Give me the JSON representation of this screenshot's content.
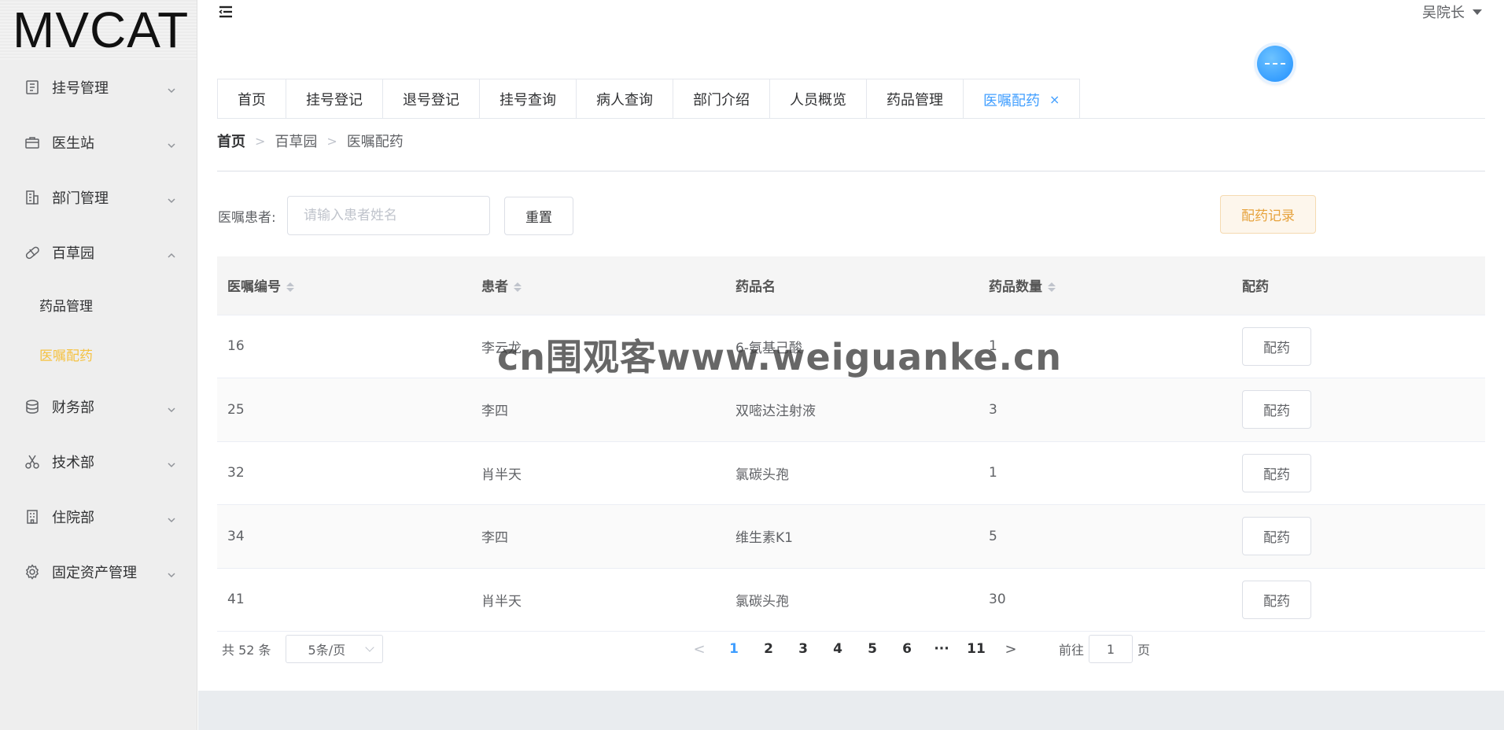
{
  "app": {
    "logo": "MVCAT"
  },
  "sidebar": {
    "items": [
      {
        "label": "挂号管理",
        "icon": "document-icon"
      },
      {
        "label": "医生站",
        "icon": "briefcase-icon"
      },
      {
        "label": "部门管理",
        "icon": "office-building-icon"
      },
      {
        "label": "百草园",
        "icon": "pill-icon",
        "expanded": true,
        "children": [
          {
            "label": "药品管理"
          },
          {
            "label": "医嘱配药",
            "active": true
          }
        ]
      },
      {
        "label": "财务部",
        "icon": "coins-icon"
      },
      {
        "label": "技术部",
        "icon": "scissors-icon"
      },
      {
        "label": "住院部",
        "icon": "building-icon"
      },
      {
        "label": "固定资产管理",
        "icon": "gear-icon"
      }
    ]
  },
  "header": {
    "user": "吴院长"
  },
  "tabs": [
    {
      "label": "首页"
    },
    {
      "label": "挂号登记"
    },
    {
      "label": "退号登记"
    },
    {
      "label": "挂号查询"
    },
    {
      "label": "病人查询"
    },
    {
      "label": "部门介绍"
    },
    {
      "label": "人员概览"
    },
    {
      "label": "药品管理"
    },
    {
      "label": "医嘱配药",
      "active": true,
      "close": "×"
    }
  ],
  "breadcrumb": [
    "首页",
    "百草园",
    "医嘱配药"
  ],
  "filter": {
    "label": "医嘱患者:",
    "placeholder": "请输入患者姓名",
    "value": "",
    "reset_label": "重置",
    "record_label": "配药记录"
  },
  "table": {
    "columns": [
      "医嘱编号",
      "患者",
      "药品名",
      "药品数量",
      "配药"
    ],
    "sortable": [
      true,
      true,
      false,
      true,
      false
    ],
    "rows": [
      {
        "id": "16",
        "patient": "李云龙",
        "drug": "6-氨基己酸",
        "qty": "1",
        "action": "配药"
      },
      {
        "id": "25",
        "patient": "李四",
        "drug": "双嘧达注射液",
        "qty": "3",
        "action": "配药"
      },
      {
        "id": "32",
        "patient": "肖半天",
        "drug": "氯碳头孢",
        "qty": "1",
        "action": "配药"
      },
      {
        "id": "34",
        "patient": "李四",
        "drug": "维生素K1",
        "qty": "5",
        "action": "配药"
      },
      {
        "id": "41",
        "patient": "肖半天",
        "drug": "氯碳头孢",
        "qty": "30",
        "action": "配药"
      }
    ]
  },
  "pagination": {
    "total_text": "共 52 条",
    "page_size": "5条/页",
    "pages": [
      "1",
      "2",
      "3",
      "4",
      "5",
      "6",
      "···",
      "11"
    ],
    "current": "1",
    "prev": "<",
    "next": ">",
    "goto_prefix": "前往",
    "goto_value": "1",
    "goto_suffix": "页"
  },
  "watermark": "cn围观客www.weiguanke.cn",
  "colors": {
    "accent": "#409eff",
    "active_menu": "#f5c242",
    "warning": "#e6a23c"
  }
}
